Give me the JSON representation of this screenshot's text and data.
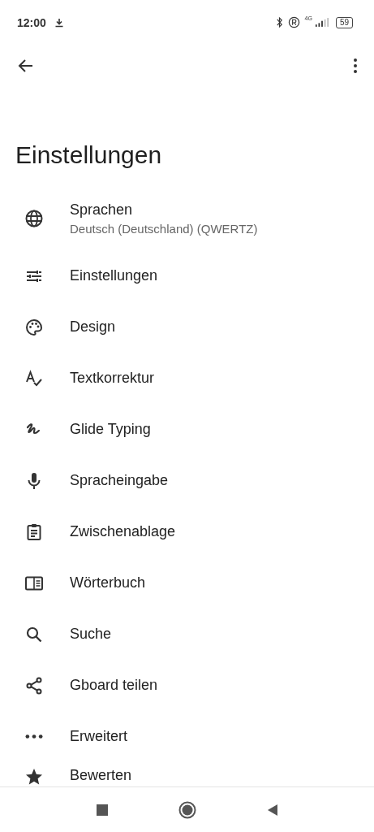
{
  "status_bar": {
    "time": "12:00",
    "battery": "59",
    "network": "4G"
  },
  "title": "Einstellungen",
  "items": [
    {
      "label": "Sprachen",
      "subtitle": "Deutsch (Deutschland) (QWERTZ)"
    },
    {
      "label": "Einstellungen"
    },
    {
      "label": "Design"
    },
    {
      "label": "Textkorrektur"
    },
    {
      "label": "Glide Typing"
    },
    {
      "label": "Spracheingabe"
    },
    {
      "label": "Zwischenablage"
    },
    {
      "label": "Wörterbuch"
    },
    {
      "label": "Suche"
    },
    {
      "label": "Gboard teilen"
    },
    {
      "label": "Erweitert"
    },
    {
      "label": "Bewerten"
    }
  ]
}
